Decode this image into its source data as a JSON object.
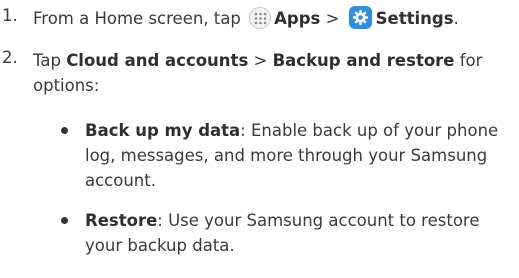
{
  "step1": {
    "number": "1.",
    "text_before": "From a Home screen, tap",
    "apps_label": "Apps",
    "separator": ">",
    "settings_label": "Settings",
    "end": "."
  },
  "step2": {
    "number": "2.",
    "text_before": "Tap",
    "cloud_label": "Cloud and accounts",
    "separator": ">",
    "backup_label": "Backup and restore",
    "text_after": " for options:"
  },
  "bullets": [
    {
      "term": "Back up my data",
      "description": ": Enable back up of your phone log, messages, and more through your Samsung account."
    },
    {
      "term": "Restore",
      "description": ": Use your Samsung account to restore your backup data."
    }
  ],
  "icons": {
    "apps": "apps-grid-icon",
    "settings": "settings-gear-icon"
  },
  "colors": {
    "settings_icon_bg": "#2e8fe0",
    "text": "#3a3a3a"
  }
}
